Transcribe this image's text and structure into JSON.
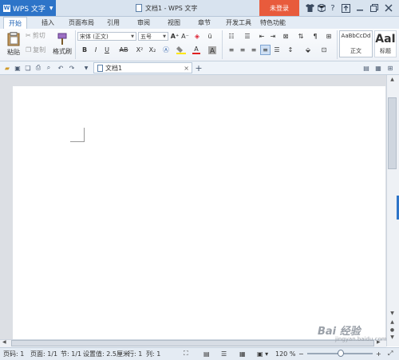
{
  "titlebar": {
    "app_name": "WPS 文字",
    "logo_letter": "W",
    "doc_title": "文档1 - WPS 文字",
    "login_label": "未登录",
    "icons": [
      "shirt-icon",
      "cube-icon",
      "help-icon",
      "upload-icon",
      "minimize-icon",
      "restore-icon",
      "close-icon"
    ],
    "help_glyph": "?"
  },
  "tabs": [
    "开始",
    "插入",
    "页面布局",
    "引用",
    "审阅",
    "视图",
    "章节",
    "开发工具",
    "特色功能"
  ],
  "ribbon": {
    "paste_label": "粘贴",
    "cut_label": "剪切",
    "copy_label": "复制",
    "format_painter_label": "格式刷",
    "font_name": "宋体 (正文)",
    "font_size": "五号",
    "bold": "B",
    "italic": "I",
    "underline": "U",
    "strike": "AB",
    "superscript": "X²",
    "subscript": "X₂",
    "font_color": "A",
    "grow_font": "A⁺",
    "shrink_font": "A⁻",
    "style_normal_preview": "AaBbCcDd",
    "style_normal_label": "正文",
    "style_title_preview": "AaI",
    "style_title_label": "标题"
  },
  "qbar": {
    "doc_tab_label": "文档1",
    "close_glyph": "×",
    "new_tab_glyph": "+"
  },
  "status": {
    "page_num": "页码: 1",
    "page_of": "页面: 1/1",
    "section": "节: 1/1",
    "setting": "设置值: 2.5厘米",
    "row": "行: 1",
    "col": "列: 1",
    "zoom": "120 %",
    "zoom_minus": "−",
    "zoom_plus": "+"
  },
  "watermark": {
    "text": "Bai 经验",
    "url": "jingyan.baidu.com"
  },
  "colors": {
    "accent": "#2d74c8",
    "login": "#e85b3c",
    "titlebar": "#d8e3ef"
  }
}
